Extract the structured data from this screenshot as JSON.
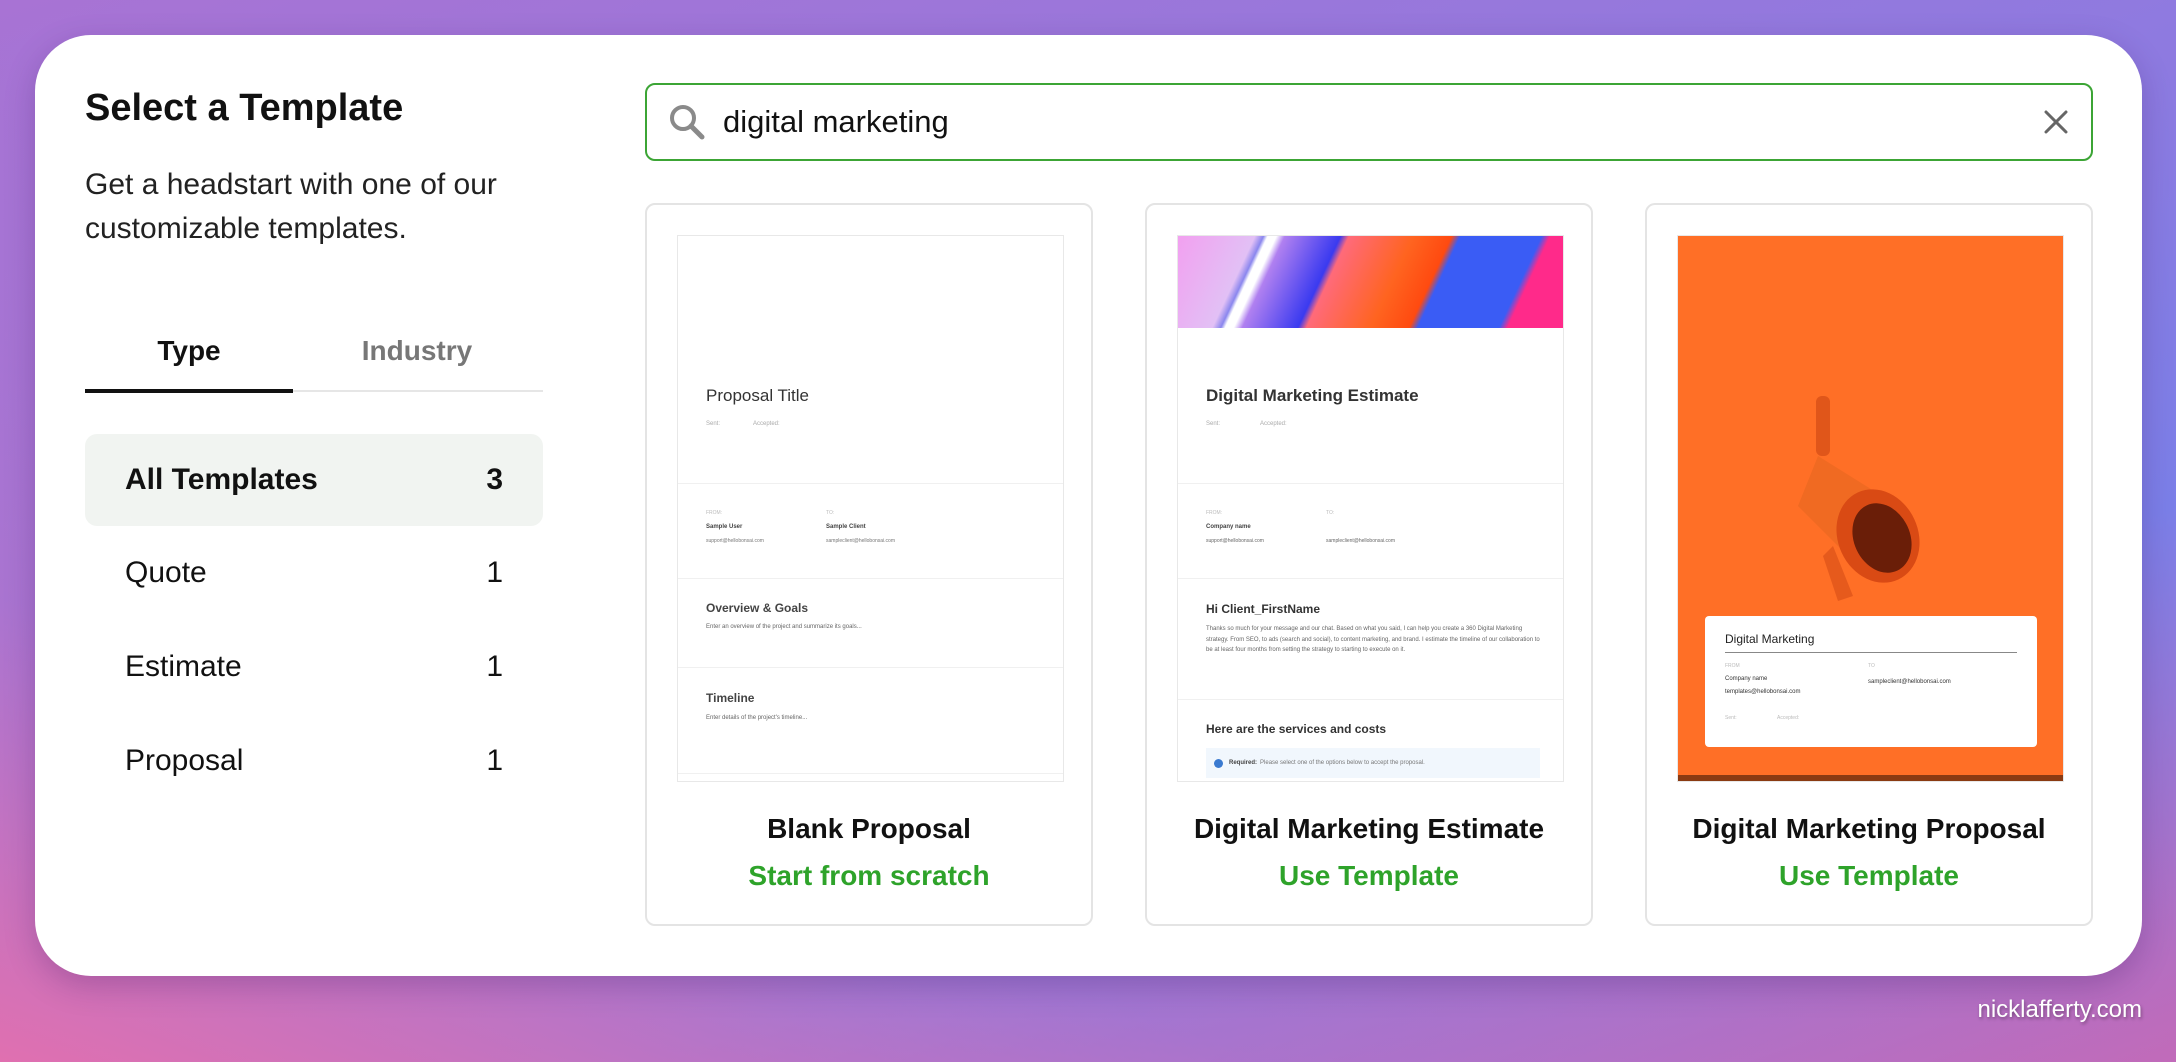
{
  "sidebar": {
    "title": "Select a Template",
    "subtitle": "Get a headstart with one of our customizable templates.",
    "tabs": [
      {
        "label": "Type",
        "active": true
      },
      {
        "label": "Industry",
        "active": false
      }
    ],
    "items": [
      {
        "label": "All Templates",
        "count": "3",
        "active": true
      },
      {
        "label": "Quote",
        "count": "1"
      },
      {
        "label": "Estimate",
        "count": "1"
      },
      {
        "label": "Proposal",
        "count": "1"
      }
    ]
  },
  "search": {
    "value": "digital marketing",
    "icon": "search-icon",
    "clear_icon": "close-icon",
    "accent": "#3ca535"
  },
  "cards": [
    {
      "title": "Blank Proposal",
      "action": "Start from scratch",
      "preview": {
        "title": "Proposal Title",
        "sent": "Sent:",
        "accepted": "Accepted:",
        "from": "FROM:",
        "to": "TO:",
        "from_name": "Sample User",
        "to_name": "Sample Client",
        "from_email": "support@hellobonsai.com",
        "to_email": "sampleclient@hellobonsai.com",
        "s1": "Overview & Goals",
        "s1_text": "Enter an overview of the project and summarize its goals...",
        "s2": "Timeline",
        "s2_text": "Enter details of the project's timeline..."
      }
    },
    {
      "title": "Digital Marketing Estimate",
      "action": "Use Template",
      "preview": {
        "title": "Digital Marketing Estimate",
        "sent": "Sent:",
        "accepted": "Accepted:",
        "from": "FROM:",
        "to": "TO:",
        "from_name": "Company name",
        "from_email": "support@hellobonsai.com",
        "to_email": "sampleclient@hellobonsai.com",
        "greeting": "Hi Client_FirstName",
        "body": "Thanks so much for your message and our chat. Based on what you said, I can help you create a 360 Digital Marketing strategy. From SEO, to ads (search and social), to content marketing, and brand. I estimate the timeline of our collaboration to be at least four months from setting the strategy to starting to execute on it.",
        "services": "Here are the services and costs",
        "required": "Required:",
        "required_text": "Please select one of the options below to accept the proposal."
      }
    },
    {
      "title": "Digital Marketing Proposal",
      "action": "Use Template",
      "preview": {
        "title": "Digital Marketing",
        "from": "FROM",
        "to": "TO",
        "from_name": "Company name",
        "from_email": "templates@hellobonsai.com",
        "to_email": "sampleclient@hellobonsai.com",
        "sent": "Sent:",
        "accepted": "Accepted:",
        "bg": "#ff6f26"
      }
    }
  ],
  "watermark": "nicklafferty.com"
}
